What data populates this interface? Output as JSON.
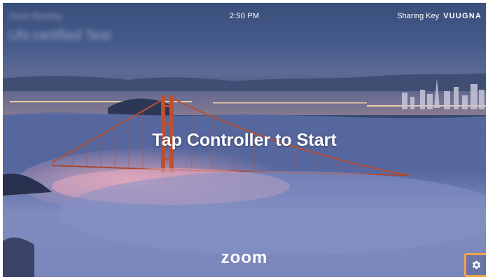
{
  "header": {
    "room_name_line1": "Zoom Meeting",
    "room_name_line2": "UN certified Test",
    "time": "2:50 PM",
    "sharing_key_label": "Sharing Key",
    "sharing_key_value": "VUUGNA"
  },
  "main": {
    "prompt": "Tap Controller to Start"
  },
  "footer": {
    "brand": "zoom",
    "settings_icon": "gear-icon"
  },
  "colors": {
    "settings_highlight": "#f3a14a",
    "text": "#ffffff"
  }
}
